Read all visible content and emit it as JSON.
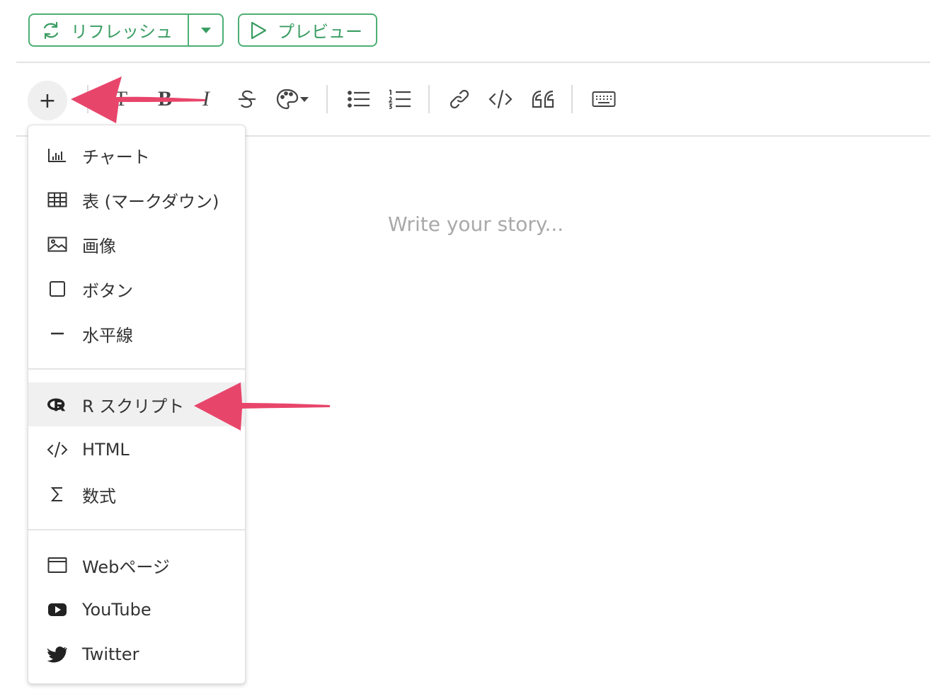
{
  "header": {
    "refresh_label": "リフレッシュ",
    "preview_label": "プレビュー"
  },
  "editor": {
    "placeholder": "Write your story..."
  },
  "insert_menu": {
    "items": [
      {
        "label": "チャート",
        "icon": "bar-chart-icon"
      },
      {
        "label": "表 (マークダウン)",
        "icon": "table-icon"
      },
      {
        "label": "画像",
        "icon": "image-icon"
      },
      {
        "label": "ボタン",
        "icon": "square-icon"
      },
      {
        "label": "水平線",
        "icon": "minus-icon"
      },
      {
        "label": "R スクリプト",
        "icon": "r-logo-icon",
        "highlighted": true
      },
      {
        "label": "HTML",
        "icon": "code-icon"
      },
      {
        "label": "数式",
        "icon": "sigma-icon"
      },
      {
        "label": "Webページ",
        "icon": "browser-window-icon"
      },
      {
        "label": "YouTube",
        "icon": "youtube-icon"
      },
      {
        "label": "Twitter",
        "icon": "twitter-icon"
      }
    ]
  },
  "colors": {
    "accent_green": "#4caf73",
    "annotation_arrow": "#e8456b"
  }
}
